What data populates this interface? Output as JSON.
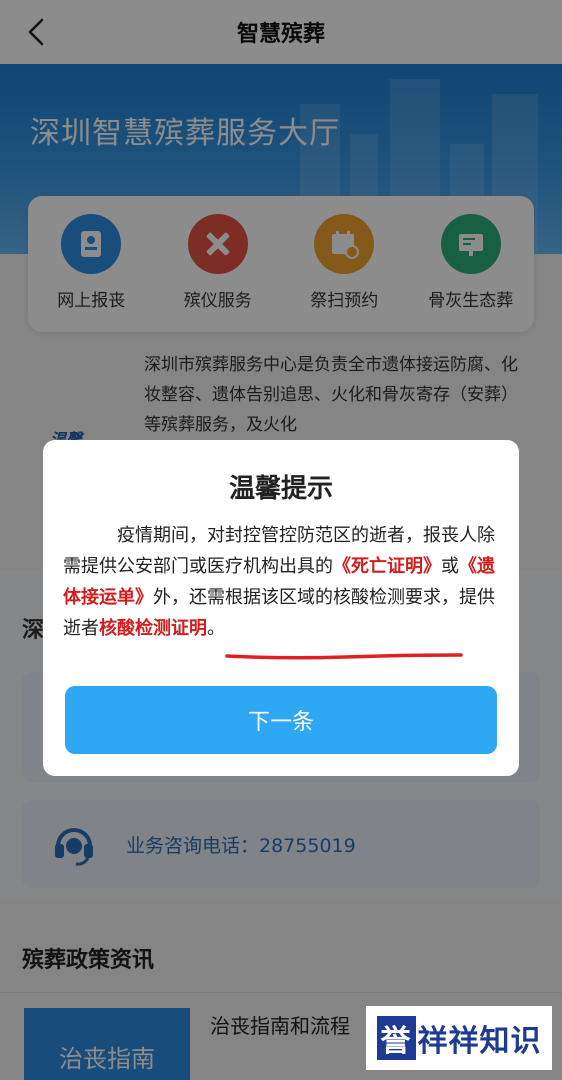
{
  "nav": {
    "title": "智慧殡葬"
  },
  "banner": {
    "title": "深圳智慧殡葬服务大厅"
  },
  "services": [
    {
      "label": "网上报丧",
      "icon": "id-card-icon",
      "color": "#2e8de0"
    },
    {
      "label": "殡仪服务",
      "icon": "tools-icon",
      "color": "#e25545"
    },
    {
      "label": "祭扫预约",
      "icon": "calendar-clock-icon",
      "color": "#f1a431"
    },
    {
      "label": "骨灰生态葬",
      "icon": "board-icon",
      "color": "#2bb07a"
    }
  ],
  "intro": {
    "text": "深圳市殡葬服务中心是负责全市遗体接运防腐、化妆整容、遗体告别追思、火化和骨灰寄存（安葬）等殡葬服务，及火化",
    "logo_text": "温馨"
  },
  "section_cut_title": "深",
  "phone": {
    "label": "业务咨询电话：28755019"
  },
  "policy": {
    "title": "殡葬政策资讯",
    "tile_label": "治丧指南",
    "item_text": "治丧指南和流程"
  },
  "watermark": {
    "first": "誉",
    "rest": "祥祥知识"
  },
  "dialog": {
    "title": "温馨提示",
    "body_part1": "疫情期间，对封控管控防范区的逝者，报丧人除需提供公安部门或医疗机构出具的",
    "red1": "《死亡证明》",
    "body_part2": "或",
    "red2": "《遗体接运单》",
    "body_part3": "外，还需根据该区域的核酸检测要求，提供逝者",
    "red3": "核酸检测证明",
    "body_part4": "。",
    "button_label": "下一条",
    "accent_color": "#2fa8f4",
    "highlight_color": "#d21e1e"
  }
}
